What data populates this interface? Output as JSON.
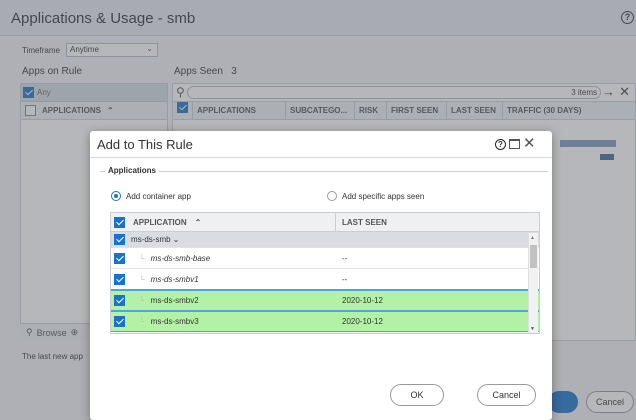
{
  "window": {
    "title": "Applications & Usage - smb",
    "help_icon": "?"
  },
  "timeframe": {
    "label": "Timeframe",
    "value": "Anytime"
  },
  "left": {
    "heading": "Apps on Rule",
    "any_label": "Any",
    "column": "APPLICATIONS",
    "browse_label": "Browse"
  },
  "right": {
    "heading": "Apps Seen",
    "count": "3",
    "items": "3 items",
    "columns": [
      "APPLICATIONS",
      "SUBCATEGO...",
      "RISK",
      "FIRST SEEN",
      "LAST SEEN",
      "TRAFFIC (30 DAYS)"
    ]
  },
  "footer_note": "The last new app",
  "bg_buttons": {
    "cancel": "Cancel"
  },
  "modal": {
    "title": "Add to This Rule",
    "section": "Applications",
    "radio_container": "Add container app",
    "radio_specific": "Add specific apps seen",
    "grid_headers": {
      "application": "APPLICATION",
      "last_seen": "LAST SEEN"
    },
    "rows": [
      {
        "name": "ms-ds-smb",
        "last_seen": ""
      },
      {
        "name": "ms-ds-smb-base",
        "last_seen": "--"
      },
      {
        "name": "ms-ds-smbv1",
        "last_seen": "--"
      },
      {
        "name": "ms-ds-smbv2",
        "last_seen": "2020-10-12"
      },
      {
        "name": "ms-ds-smbv3",
        "last_seen": "2020-10-12"
      }
    ],
    "ok_label": "OK",
    "cancel_label": "Cancel"
  },
  "colors": {
    "accent": "#1a73c8",
    "selected_row": "#b3f2a6"
  }
}
